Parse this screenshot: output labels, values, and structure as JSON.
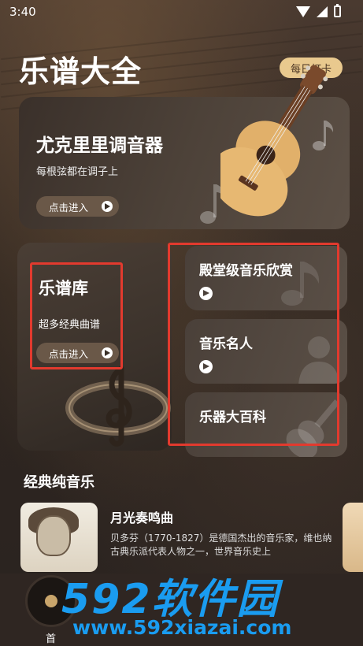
{
  "status_bar": {
    "time": "3:40"
  },
  "header": {
    "app_title": "乐谱大全",
    "checkin_label": "每日打卡"
  },
  "tuner_card": {
    "title": "尤克里里调音器",
    "subtitle": "每根弦都在调子上",
    "enter_label": "点击进入"
  },
  "library_card": {
    "title": "乐谱库",
    "subtitle": "超多经典曲谱",
    "enter_label": "点击进入"
  },
  "side_cards": [
    {
      "label": "殿堂级音乐欣赏"
    },
    {
      "label": "音乐名人"
    },
    {
      "label": "乐器大百科"
    }
  ],
  "classic_section": {
    "title": "经典纯音乐",
    "items": [
      {
        "name": "月光奏鸣曲",
        "description": "贝多芬（1770-1827）是德国杰出的音乐家，维也纳古典乐派代表人物之一，世界音乐史上"
      }
    ]
  },
  "bottom_nav": {
    "first_label": "首"
  },
  "watermark": {
    "logo": "592软件园",
    "url": "www.592xiazai.com"
  },
  "colors": {
    "accent": "#e9c98e",
    "highlight_box": "#e23a2e",
    "watermark": "#1a9cf0"
  }
}
